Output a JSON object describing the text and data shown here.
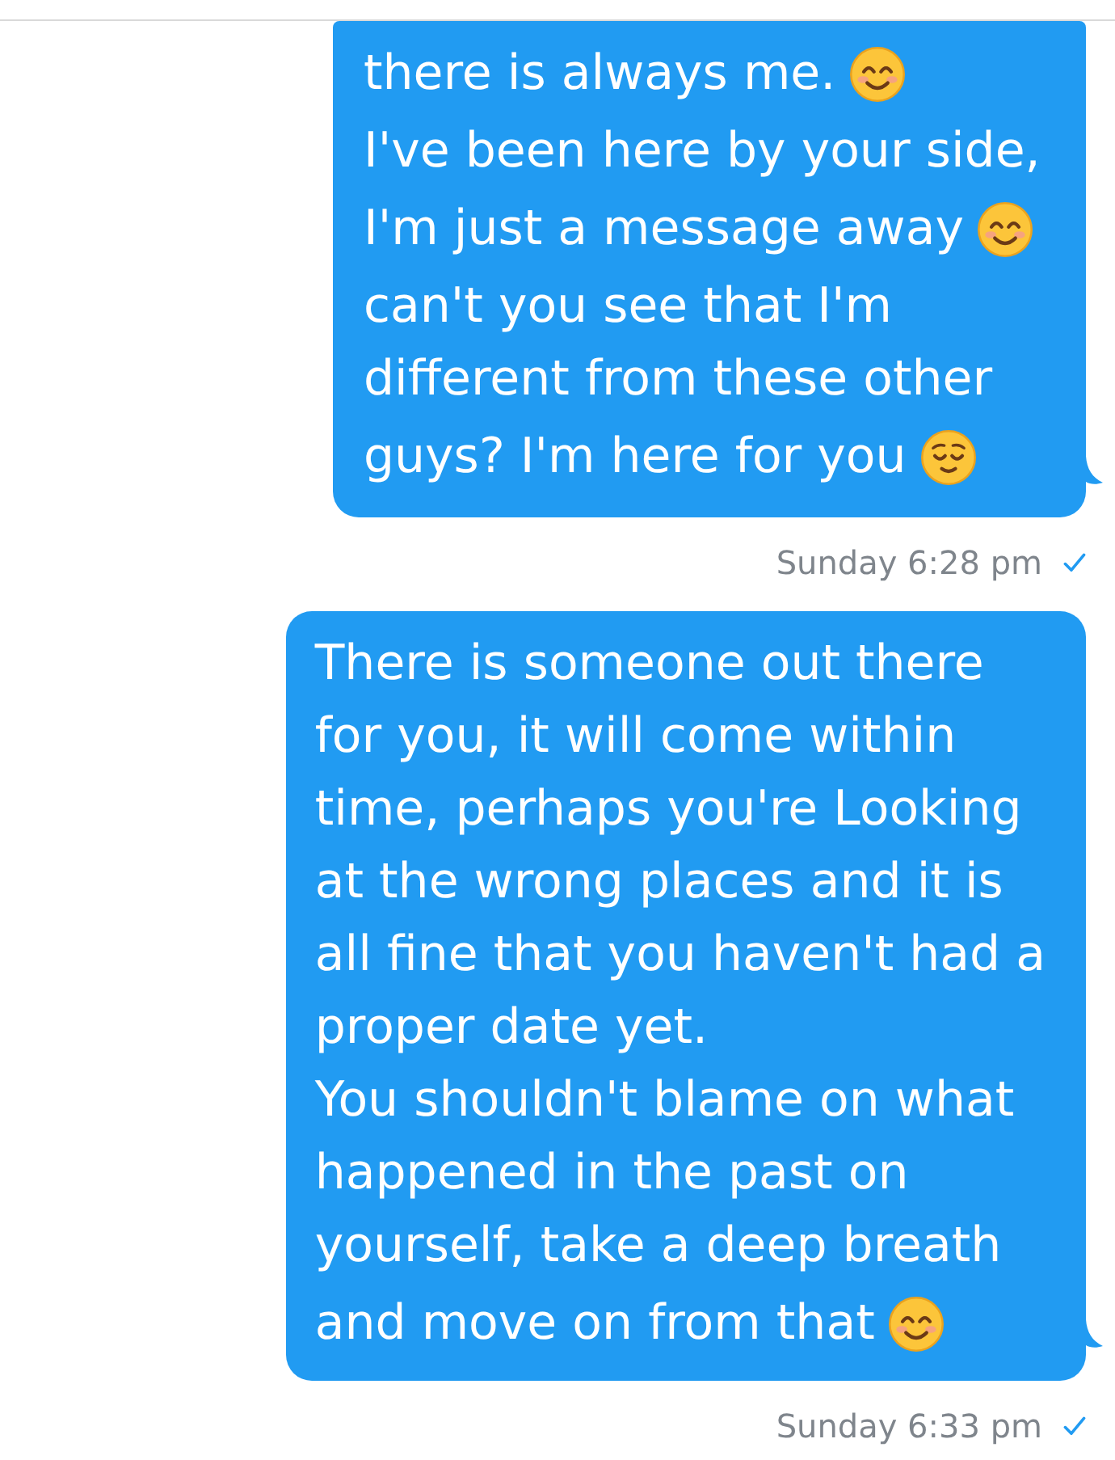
{
  "messages": [
    {
      "lines": [
        {
          "text": "there is always me.",
          "kind": "smiling"
        },
        {
          "text": "I've been here by your side,",
          "kind": "plain"
        },
        {
          "text": "I'm just a message away",
          "kind": "smiling"
        },
        {
          "text": "can't you see that I'm",
          "kind": "plain"
        },
        {
          "text": "different from these other",
          "kind": "plain"
        },
        {
          "text": "guys? I'm here for you",
          "kind": "relieved"
        }
      ],
      "timestamp": "Sunday 6:28 pm",
      "delivered": true
    },
    {
      "lines": [
        {
          "text": "There is someone out there",
          "kind": "plain"
        },
        {
          "text": "for you, it will come within",
          "kind": "plain"
        },
        {
          "text": "time, perhaps you're Looking",
          "kind": "plain"
        },
        {
          "text": "at the wrong places and it is",
          "kind": "plain"
        },
        {
          "text": "all fine that you haven't had a",
          "kind": "plain"
        },
        {
          "text": "proper date yet.",
          "kind": "plain"
        },
        {
          "text": "You shouldn't blame on what",
          "kind": "plain"
        },
        {
          "text": "happened in the past on",
          "kind": "plain"
        },
        {
          "text": "yourself, take a deep breath",
          "kind": "plain"
        },
        {
          "text": "and move on from that",
          "kind": "smiling"
        }
      ],
      "timestamp": "Sunday 6:33 pm",
      "delivered": true
    }
  ]
}
